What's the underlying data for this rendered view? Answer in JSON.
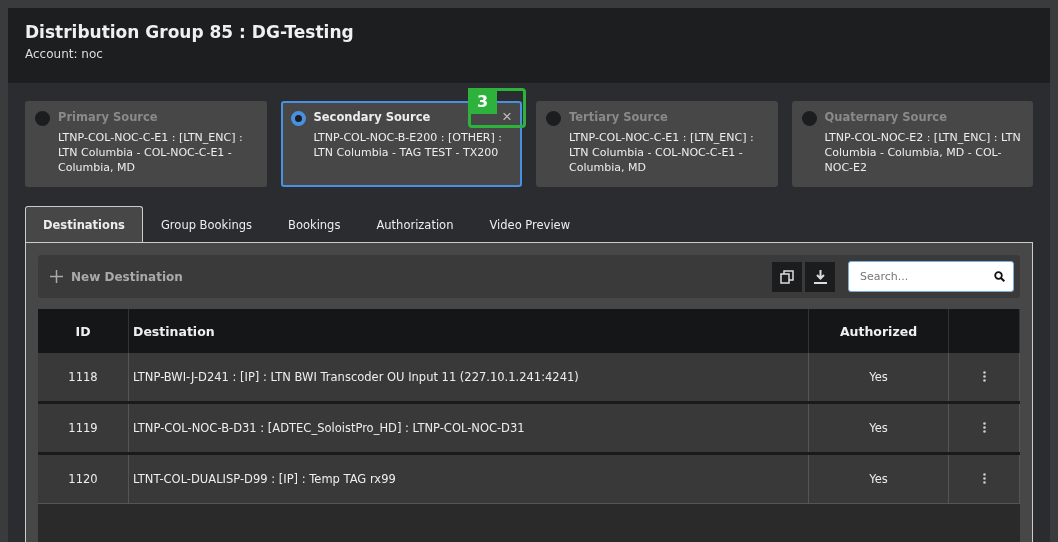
{
  "modal": {
    "title": "Distribution Group 85 : DG-Testing",
    "subtitle": "Account: noc"
  },
  "sources": [
    {
      "label": "Primary Source",
      "detail": "LTNP-COL-NOC-C-E1 : [LTN_ENC] : LTN Columbia - COL-NOC-C-E1 - Columbia, MD",
      "selected": false
    },
    {
      "label": "Secondary Source",
      "detail": "LTNP-COL-NOC-B-E200 : [OTHER] : LTN Columbia - TAG TEST - TX200",
      "selected": true,
      "remove": "×"
    },
    {
      "label": "Tertiary Source",
      "detail": "LTNP-COL-NOC-C-E1 : [LTN_ENC] : LTN Columbia - COL-NOC-C-E1 - Columbia, MD",
      "selected": false
    },
    {
      "label": "Quaternary Source",
      "detail": "LTNP-COL-NOC-E2 : [LTN_ENC] : LTN Columbia - Columbia, MD - COL-NOC-E2",
      "selected": false
    }
  ],
  "annotation": {
    "label": "3"
  },
  "tabs": [
    {
      "label": "Destinations",
      "selected": true
    },
    {
      "label": "Group Bookings",
      "selected": false
    },
    {
      "label": "Bookings",
      "selected": false
    },
    {
      "label": "Authorization",
      "selected": false
    },
    {
      "label": "Video Preview",
      "selected": false
    }
  ],
  "toolbar": {
    "new_button": "New Destination",
    "search": {
      "placeholder": "Search..."
    }
  },
  "table": {
    "columns": [
      "ID",
      "Destination",
      "Authorized"
    ],
    "rows": [
      {
        "id": "1118",
        "destination": "LTNP-BWI-J-D241 : [IP] : LTN BWI Transcoder OU Input 11 (227.10.1.241:4241)",
        "authorized": "Yes"
      },
      {
        "id": "1119",
        "destination": "LTNP-COL-NOC-B-D31 : [ADTEC_SoloistPro_HD] : LTNP-COL-NOC-D31",
        "authorized": "Yes"
      },
      {
        "id": "1120",
        "destination": "LTNT-COL-DUALISP-D99 : [IP] : Temp TAG rx99",
        "authorized": "Yes"
      }
    ]
  }
}
